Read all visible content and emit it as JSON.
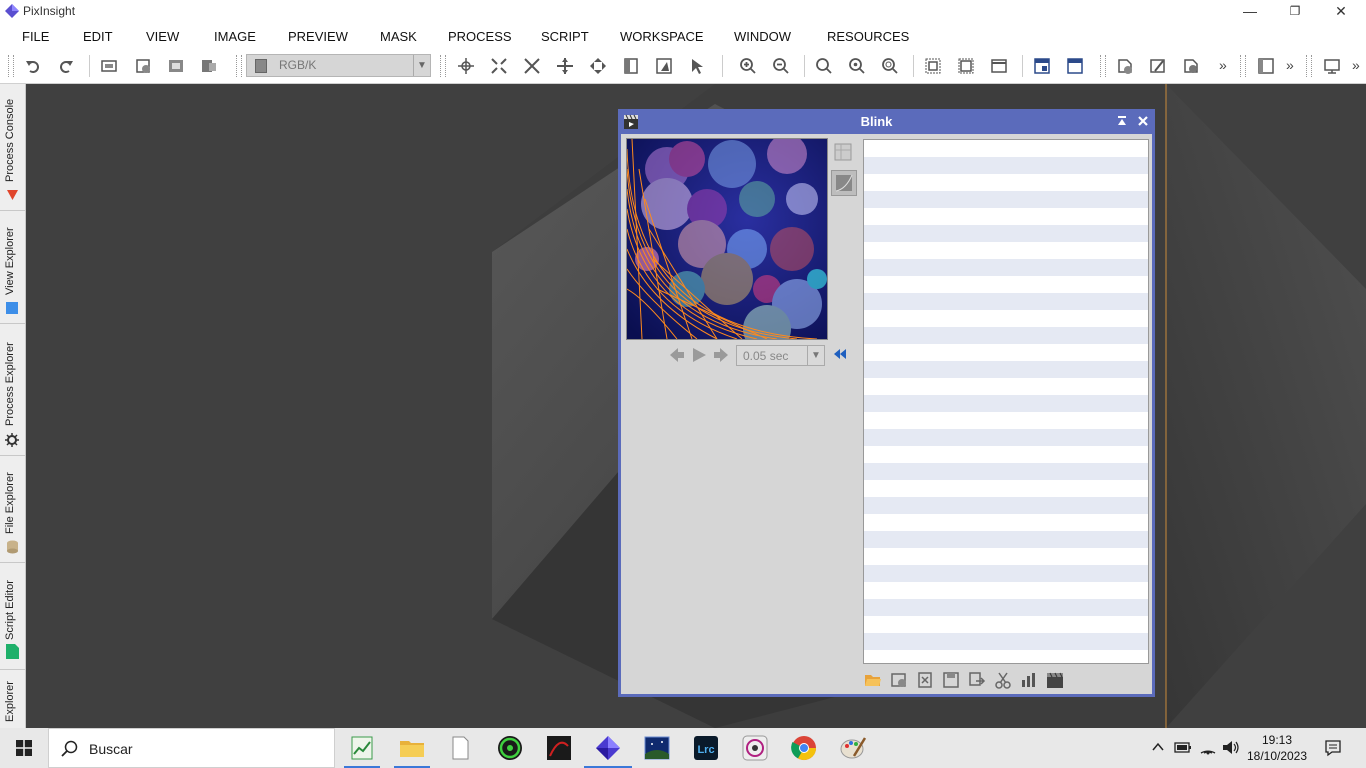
{
  "app": {
    "title": "PixInsight"
  },
  "window_controls": {
    "minimize": "—",
    "restore": "❐",
    "close": "✕"
  },
  "menu": [
    "FILE",
    "EDIT",
    "VIEW",
    "IMAGE",
    "PREVIEW",
    "MASK",
    "PROCESS",
    "SCRIPT",
    "WORKSPACE",
    "WINDOW",
    "RESOURCES"
  ],
  "toolbar": {
    "channel_select": "RGB/K",
    "overflow1": "»",
    "overflow2": "»",
    "overflow3": "»"
  },
  "side_tabs": [
    "Process Console",
    "View Explorer",
    "Process Explorer",
    "File Explorer",
    "Script Editor",
    "Explorer"
  ],
  "blink": {
    "title": "Blink",
    "interval": "0.05 sec"
  },
  "taskbar": {
    "search_placeholder": "Buscar",
    "time": "19:13",
    "date": "18/10/2023"
  },
  "colors": {
    "accent": "#5b6bbb",
    "taskbar_active": "#3b78d8"
  }
}
